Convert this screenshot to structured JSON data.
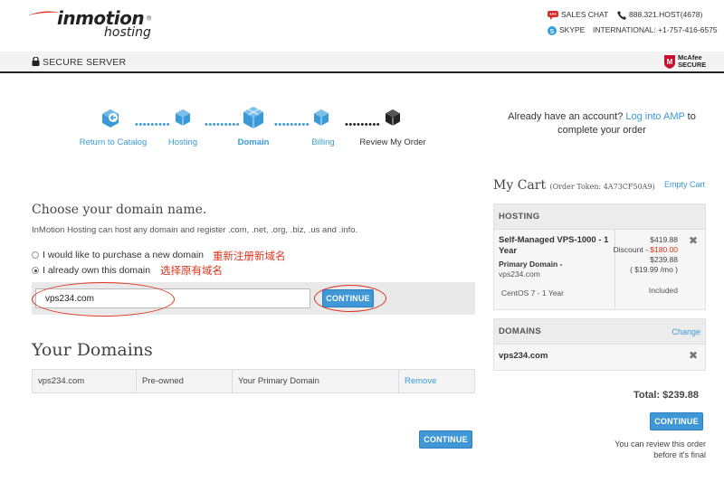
{
  "header": {
    "logo_main": "inmotion",
    "logo_sub": "hosting",
    "sales_chat": "SALES CHAT",
    "phone": "888.321.HOST(4678)",
    "skype": "SKYPE",
    "international": "INTERNATIONAL: +1-757-416-6575",
    "secure_server": "SECURE SERVER",
    "mcafee_line1": "McAfee",
    "mcafee_line2": "SECURE"
  },
  "steps": [
    {
      "label": "Return to Catalog"
    },
    {
      "label": "Hosting"
    },
    {
      "label": "Domain"
    },
    {
      "label": "Billing"
    },
    {
      "label": "Review My Order"
    }
  ],
  "account": {
    "prefix": "Already have an account? ",
    "link": "Log into AMP",
    "suffix": " to complete your order"
  },
  "domain": {
    "title": "Choose your domain name.",
    "description": "InMotion Hosting can host any domain and register .com, .net, .org, .biz, .us and .info.",
    "option_new": "I would like to purchase a new domain",
    "option_own": "I already own this domain",
    "note_new": "重新注册新域名",
    "note_own": "选择原有域名",
    "input_value": "vps234.com",
    "continue_label": "CONTINUE"
  },
  "your_domains": {
    "title": "Your Domains",
    "rows": [
      {
        "domain": "vps234.com",
        "status": "Pre-owned",
        "role": "Your Primary Domain",
        "action": "Remove"
      }
    ],
    "continue_label": "CONTINUE"
  },
  "cart": {
    "title": "My Cart",
    "token": "(Order Token: 4A73CF50A9)",
    "empty": "Empty Cart",
    "hosting_head": "HOSTING",
    "item_name": "Self-Managed VPS-1000 - 1 Year",
    "primary_domain_label": "Primary Domain -",
    "primary_domain": "vps234.com",
    "price": "$419.88",
    "discount_label": "Discount - ",
    "discount_value": "$180.00",
    "subtotal": "$239.88",
    "monthly": "( $19.99 /mo )",
    "os": "CentOS 7 - 1 Year",
    "os_price": "Included",
    "domains_head": "DOMAINS",
    "change": "Change",
    "domain_item": "vps234.com",
    "total": "Total: $239.88",
    "continue_label": "CONTINUE",
    "review_note": "You can review this order before it's final"
  },
  "colors": {
    "accent": "#3a9ad9",
    "annotation": "#e0321c",
    "discount": "#e0321c"
  }
}
